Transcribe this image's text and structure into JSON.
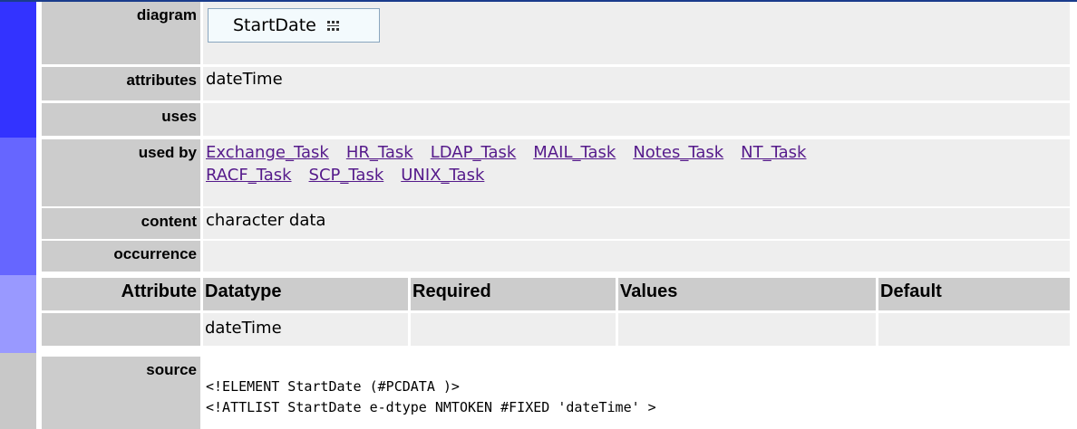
{
  "labels": {
    "diagram": "diagram",
    "attributes": "attributes",
    "uses": "uses",
    "used_by": "used by",
    "content": "content",
    "occurrence": "occurrence",
    "attribute": "Attribute",
    "source": "source"
  },
  "diagram": {
    "element_name": "StartDate",
    "icon": "sequence-icon"
  },
  "attributes": "dateTime",
  "uses": "",
  "used_by": [
    "Exchange_Task",
    "HR_Task",
    "LDAP_Task",
    "MAIL_Task",
    "Notes_Task",
    "NT_Task",
    "RACF_Task",
    "SCP_Task",
    "UNIX_Task"
  ],
  "content": "character data",
  "occurrence": "",
  "attribute_table": {
    "headers": [
      "Datatype",
      "Required",
      "Values",
      "Default"
    ],
    "row": [
      "dateTime",
      "",
      "",
      ""
    ]
  },
  "source": {
    "line1": "<!ELEMENT StartDate (#PCDATA )>",
    "line2": "<!ATTLIST StartDate e-dtype NMTOKEN #FIXED 'dateTime' >"
  },
  "colors": {
    "stripe1": "#3333ff",
    "stripe2": "#6666ff",
    "stripe3": "#9999ff",
    "stripe4": "#c8c8c8",
    "label_bg": "#cccccc",
    "value_bg": "#eeeeee",
    "link": "#551a8b"
  }
}
